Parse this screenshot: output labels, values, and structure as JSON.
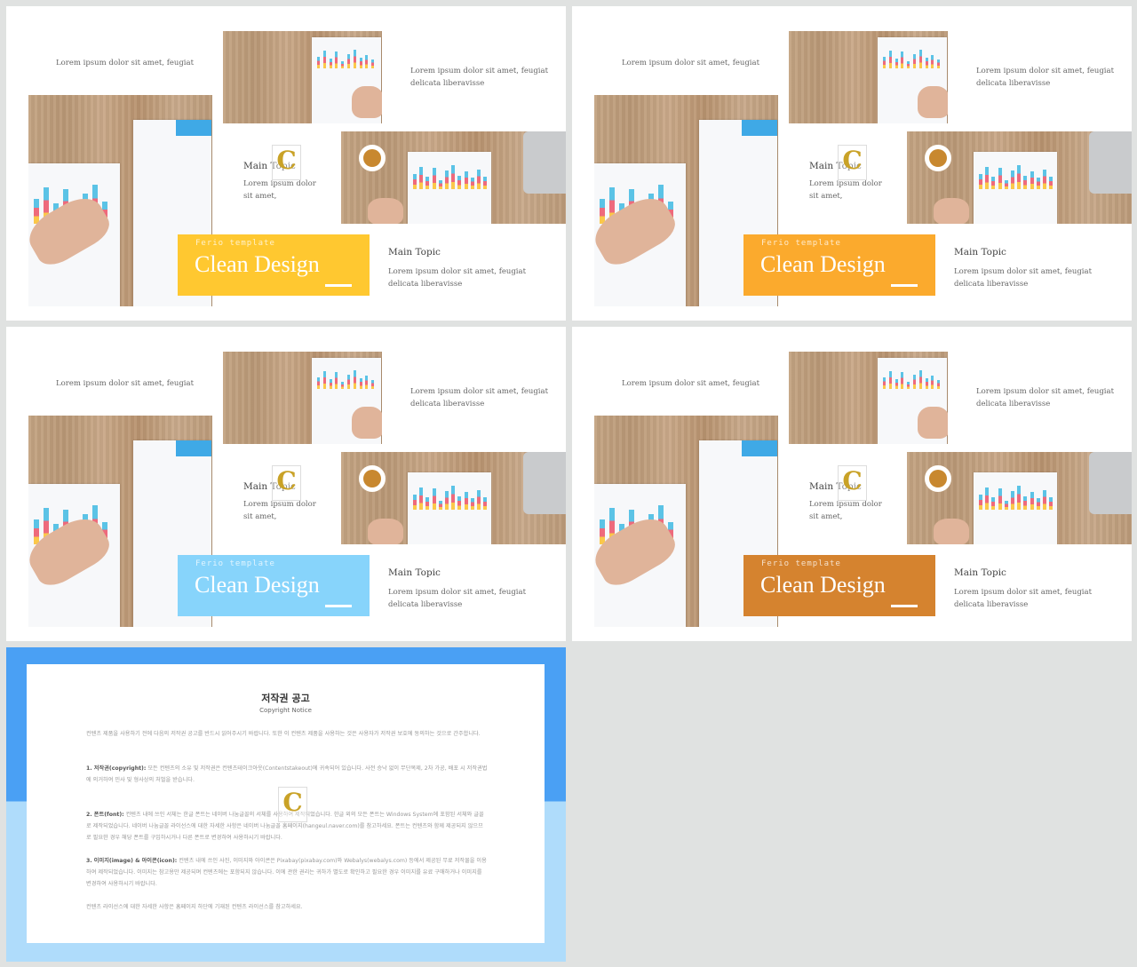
{
  "slides": [
    {
      "accent": "#ffc830",
      "template_label": "Ferio template",
      "title": "Clean Design",
      "top_left_text": "Lorem ipsum dolor sit amet, feugiat",
      "top_right_text_1": "Lorem ipsum dolor sit amet, feugiat",
      "top_right_text_2": "delicata liberavisse",
      "middle_topic": "Main Topic",
      "middle_text_1": "Lorem ipsum dolor",
      "middle_text_2": "sit amet,",
      "bottom_topic": "Main Topic",
      "bottom_text_1": "Lorem ipsum dolor sit amet, feugiat",
      "bottom_text_2": "delicata liberavisse",
      "watermark": "C"
    },
    {
      "accent": "#fbaa2d",
      "template_label": "Ferio template",
      "title": "Clean Design",
      "top_left_text": "Lorem ipsum dolor sit amet, feugiat",
      "top_right_text_1": "Lorem ipsum dolor sit amet, feugiat",
      "top_right_text_2": "delicata liberavisse",
      "middle_topic": "Main Topic",
      "middle_text_1": "Lorem ipsum dolor",
      "middle_text_2": "sit amet,",
      "bottom_topic": "Main Topic",
      "bottom_text_1": "Lorem ipsum dolor sit amet, feugiat",
      "bottom_text_2": "delicata liberavisse",
      "watermark": "C"
    },
    {
      "accent": "#87d4fb",
      "template_label": "Ferio template",
      "title": "Clean Design",
      "top_left_text": "Lorem ipsum dolor sit amet, feugiat",
      "top_right_text_1": "Lorem ipsum dolor sit amet, feugiat",
      "top_right_text_2": "delicata liberavisse",
      "middle_topic": "Main Topic",
      "middle_text_1": "Lorem ipsum dolor",
      "middle_text_2": "sit amet,",
      "bottom_topic": "Main Topic",
      "bottom_text_1": "Lorem ipsum dolor sit amet, feugiat",
      "bottom_text_2": "delicata liberavisse",
      "watermark": "C"
    },
    {
      "accent": "#d5832f",
      "template_label": "Ferio template",
      "title": "Clean Design",
      "top_left_text": "Lorem ipsum dolor sit amet, feugiat",
      "top_right_text_1": "Lorem ipsum dolor sit amet, feugiat",
      "top_right_text_2": "delicata liberavisse",
      "middle_topic": "Main Topic",
      "middle_text_1": "Lorem ipsum dolor",
      "middle_text_2": "sit amet,",
      "bottom_topic": "Main Topic",
      "bottom_text_1": "Lorem ipsum dolor sit amet, feugiat",
      "bottom_text_2": "delicata liberavisse",
      "watermark": "C"
    }
  ],
  "copyright": {
    "title": "저작권 공고",
    "subtitle": "Copyright Notice",
    "intro": "컨텐츠 제품을 사용하기 전에 다음의 저작권 공고를 반드시 읽어주시기 바랍니다. 또한 이 컨텐츠 제품을 사용하는 것은 사용자가 저작권 보호에 동의하는 것으로 간주합니다.",
    "item1_label": "1. 저작권(copyright):",
    "item1_text": "모든 컨텐츠의 소유 및 저작권은 컨텐츠테이크아웃(Contentstakeout)에 귀속되어 있습니다. 사전 승낙 없이 무단복제, 2차 가공, 배포 시 저작권법에 의거하여 민사 및 형사상의 처벌을 받습니다.",
    "item2_label": "2. 폰트(font):",
    "item2_text": "컨텐츠 내에 쓰인 서체는 한글 폰트는 네이버 나눔글꼴의 서체를 사용하여 제작되었습니다. 한글 외의 모든 폰트는 Windows System에 포함된 서체와 글꼴로 제작되었습니다. 네이버 나눔글꼴 라이선스에 대한 자세한 사항은 네이버 나눔글꼴 홈페이지(hangeul.naver.com)를 참고하세요. 폰트는 컨텐츠와 함께 제공되지 않으므로 필요한 경우 해당 폰트를 구입하시거나 다른 폰트로 변경하여 사용하시기 바랍니다.",
    "item3_label": "3. 이미지(image) & 아이콘(icon):",
    "item3_text": "컨텐츠 내에 쓰인 사진, 이미지와 아이콘은 Pixabay(pixabay.com)와 Webalys(webalys.com) 등에서 제공된 무료 저작물을 이용하여 제작되었습니다. 이미지는 참고용만 제공되며 컨텐츠에는 포함되지 않습니다. 이에 관한 권리는 귀하가 별도로 확인하고 필요한 경우 이미지를 유료 구매하거나 이미지를 변경하여 사용하시기 바랍니다.",
    "footer": "컨텐츠 라이선스에 대한 자세한 사항은 홈페이지 하단에 기재된 컨텐츠 라이선스를 참고하세요.",
    "watermark": "C"
  }
}
